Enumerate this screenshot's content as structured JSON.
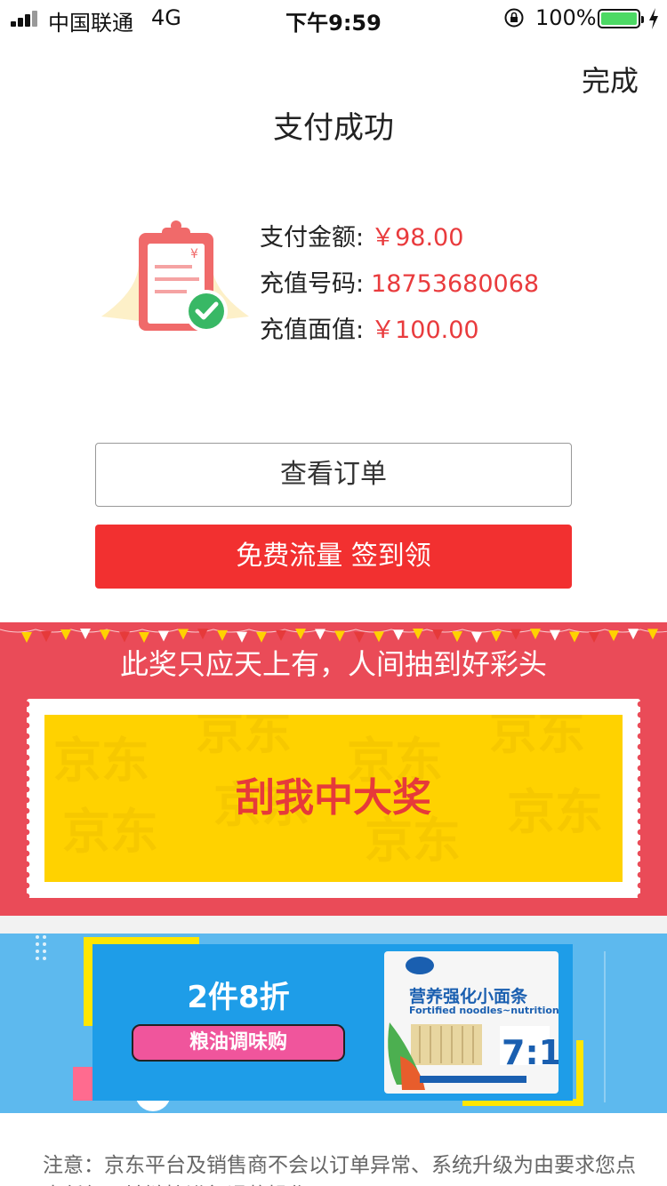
{
  "status_bar": {
    "carrier": "中国联通",
    "network": "4G",
    "time": "下午9:59",
    "battery_percent": "100%"
  },
  "header": {
    "done_label": "完成",
    "title": "支付成功"
  },
  "payment": {
    "rows": [
      {
        "label": "支付金额:",
        "value": "￥98.00"
      },
      {
        "label": "充值号码:",
        "value": "18753680068"
      },
      {
        "label": "充值面值:",
        "value": "￥100.00"
      }
    ]
  },
  "actions": {
    "view_order_label": "查看订单",
    "free_flow_label": "免费流量 签到领"
  },
  "scratch": {
    "slogan": "此奖只应天上有，人间抽到好彩头",
    "card_text": "刮我中大奖",
    "watermark_text": "京东"
  },
  "banner": {
    "discount_text": "2件8折",
    "tag_text": "粮油调味购",
    "product_title": "营养强化小面条",
    "product_subtitle": "Fortified noodles~nutrition",
    "product_ratio": "7:1"
  },
  "notice": {
    "text": "注意：京东平台及销售商不会以订单异常、系统升级为由要求您点击任何网址链接进行退款操作。"
  },
  "colors": {
    "price_red": "#e93b3d",
    "primary_red": "#f23030",
    "scratch_bg": "#ea4b58",
    "scratch_yellow": "#ffd200",
    "banner_blue": "#5db9ee"
  }
}
